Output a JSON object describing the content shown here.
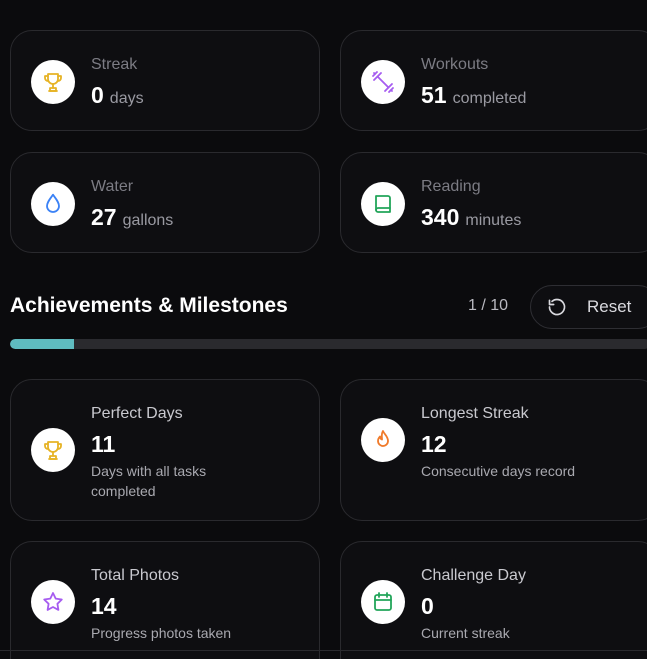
{
  "stats": [
    {
      "label": "Streak",
      "value": "0",
      "unit": "days",
      "icon": "trophy-icon",
      "color": "#e6b325"
    },
    {
      "label": "Workouts",
      "value": "51",
      "unit": "completed",
      "icon": "dumbbell-icon",
      "color": "#a65cf0"
    },
    {
      "label": "Water",
      "value": "27",
      "unit": "gallons",
      "icon": "droplet-icon",
      "color": "#3b82f6"
    },
    {
      "label": "Reading",
      "value": "340",
      "unit": "minutes",
      "icon": "book-icon",
      "color": "#22a55a"
    }
  ],
  "achievements": {
    "title": "Achievements & Milestones",
    "pager": "1 / 10",
    "reset_label": "Reset",
    "progress_fraction": 0.1,
    "progress_color": "#5fbcc0",
    "items": [
      {
        "title": "Perfect Days",
        "value": "11",
        "desc": "Days with all tasks completed",
        "icon": "trophy-icon",
        "color": "#e6b325"
      },
      {
        "title": "Longest Streak",
        "value": "12",
        "desc": "Consecutive days record",
        "icon": "flame-icon",
        "color": "#f07a2a"
      },
      {
        "title": "Total Photos",
        "value": "14",
        "desc": "Progress photos taken",
        "icon": "star-icon",
        "color": "#a65cf0"
      },
      {
        "title": "Challenge Day",
        "value": "0",
        "desc": "Current streak",
        "icon": "calendar-icon",
        "color": "#22a55a"
      }
    ]
  }
}
